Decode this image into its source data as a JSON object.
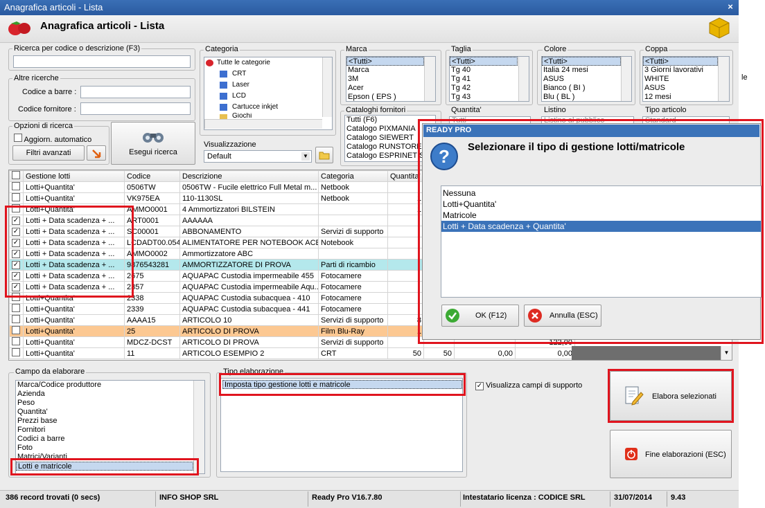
{
  "window": {
    "title": "Anagrafica articoli  - Lista",
    "close": "×"
  },
  "header": {
    "title": "Anagrafica articoli  - Lista"
  },
  "search": {
    "label": "Ricerca per codice o descrizione (F3)",
    "value": ""
  },
  "altre": {
    "label": "Altre ricerche",
    "barcode_label": "Codice a barre :",
    "supplier_label": "Codice fornitore :"
  },
  "options": {
    "label": "Opzioni di ricerca",
    "auto": "Aggiorn. automatico",
    "filters": "Filtri avanzati",
    "search_btn": "Esegui ricerca"
  },
  "categoria": {
    "label": "Categoria",
    "items": [
      "Tutte le categorie",
      "CRT",
      "Laser",
      "LCD",
      "Cartucce inkjet",
      "Giochi"
    ]
  },
  "marca": {
    "label": "Marca",
    "items": [
      "<Tutti>",
      "Marca",
      "3M",
      "Acer",
      "Epson ( EPS )"
    ]
  },
  "taglia": {
    "label": "Taglia",
    "items": [
      "<Tutti>",
      "Tg 40",
      "Tg 41",
      "Tg 42",
      "Tg 43"
    ]
  },
  "colore": {
    "label": "Colore",
    "items": [
      "<Tutti>",
      "Italia 24 mesi",
      "ASUS",
      "Bianco ( BI )",
      "Blu ( BL )"
    ]
  },
  "coppa": {
    "label": "Coppa",
    "items": [
      "<Tutti>",
      "3 Giorni lavorativi",
      "WHITE",
      "ASUS",
      "12 mesi"
    ]
  },
  "cataloghi": {
    "label": "Cataloghi fornitori",
    "items": [
      "Tutti (F6)",
      "Catalogo PIXMANIA",
      "Catalogo SIEWERT",
      "Catalogo RUNSTORE",
      "Catalogo ESPRINET SPA"
    ]
  },
  "quantita": {
    "label": "Quantita'",
    "value": "Tutti"
  },
  "listino": {
    "label": "Listino",
    "value": "Listino al pubblico"
  },
  "tipo_articolo": {
    "label": "Tipo articolo",
    "value": "Standard"
  },
  "visualizzazione": {
    "label": "Visualizzazione",
    "value": "Default"
  },
  "side_text": "le",
  "grid": {
    "headers": [
      "Gestione lotti",
      "Codice",
      "Descrizione",
      "Categoria",
      "Quantita'"
    ],
    "rows": [
      {
        "checked": false,
        "lotti": "Lotti+Quantita'",
        "codice": "0506TW",
        "desc": "0506TW  - Fucile elettrico Full Metal m...",
        "cat": "Netbook",
        "q": "",
        "bg": "#ffffff"
      },
      {
        "checked": false,
        "lotti": "Lotti+Quantita'",
        "codice": "VK975EA",
        "desc": "110-1130SL",
        "cat": "Netbook",
        "q": "1",
        "bg": "#ffffff"
      },
      {
        "checked": false,
        "lotti": "Lotti+Quantita'",
        "codice": "AMMO0001",
        "desc": "4 Ammortizzatori BILSTEIN",
        "cat": "",
        "q": "1",
        "bg": "#ffffff"
      },
      {
        "checked": true,
        "lotti": "Lotti + Data scadenza + ...",
        "codice": "ART0001",
        "desc": "AAAAAA",
        "cat": "",
        "q": "",
        "bg": "#ffffff"
      },
      {
        "checked": true,
        "lotti": "Lotti + Data scadenza + ...",
        "codice": "SC00001",
        "desc": "ABBONAMENTO",
        "cat": "Servizi di supporto",
        "q": "",
        "bg": "#ffffff"
      },
      {
        "checked": true,
        "lotti": "Lotti + Data scadenza + ...",
        "codice": "LCDADT00.054",
        "desc": "ALIMENTATORE PER NOTEBOOK ACER",
        "cat": "Notebook",
        "q": "",
        "bg": "#ffffff"
      },
      {
        "checked": true,
        "lotti": "Lotti + Data scadenza + ...",
        "codice": "AMMO0002",
        "desc": "Ammortizzatore ABC",
        "cat": "",
        "q": "",
        "bg": "#ffffff"
      },
      {
        "checked": true,
        "lotti": "Lotti + Data scadenza + ...",
        "codice": "9876543281",
        "desc": "AMMORTIZZATORE DI PROVA",
        "cat": "Parti di ricambio",
        "q": "",
        "bg": "#b4e8ec"
      },
      {
        "checked": true,
        "lotti": "Lotti + Data scadenza + ...",
        "codice": "2675",
        "desc": "AQUAPAC Custodia impermeabile 455",
        "cat": "Fotocamere",
        "q": "",
        "bg": "#ffffff"
      },
      {
        "checked": true,
        "lotti": "Lotti + Data scadenza + ...",
        "codice": "2357",
        "desc": "AQUAPAC Custodia impermeabile Aqu...",
        "cat": "Fotocamere",
        "q": "",
        "bg": "#ffffff"
      },
      {
        "checked": false,
        "lotti": "Lotti+Quantita'",
        "codice": "2338",
        "desc": "AQUAPAC Custodia subacquea - 410",
        "cat": "Fotocamere",
        "q": "",
        "bg": "#ffffff"
      },
      {
        "checked": false,
        "lotti": "Lotti+Quantita'",
        "codice": "2339",
        "desc": "AQUAPAC Custodia subacquea - 441",
        "cat": "Fotocamere",
        "q": "",
        "bg": "#ffffff"
      },
      {
        "checked": false,
        "lotti": "Lotti+Quantita'",
        "codice": "AAAA15",
        "desc": "ARTICOLO 10",
        "cat": "Servizi di supporto",
        "q": "8",
        "bg": "#ffffff"
      },
      {
        "checked": false,
        "lotti": "Lotti+Quantita'",
        "codice": "25",
        "desc": "ARTICOLO DI PROVA",
        "cat": "Film Blu-Ray",
        "q": "1",
        "bg": "#fcc892"
      },
      {
        "checked": false,
        "lotti": "Lotti+Quantita'",
        "codice": "MDCZ-DCST",
        "desc": "ARTICOLO DI PROVA",
        "cat": "Servizi di supporto",
        "q": "",
        "bg": "#ffffff"
      },
      {
        "checked": false,
        "lotti": "Lotti+Quantita'",
        "codice": "11",
        "desc": "ARTICOLO ESEMPIO 2",
        "cat": "CRT",
        "q": "50",
        "bg": "#ffffff"
      }
    ],
    "last_extra": [
      "50",
      "0,00",
      "0,00"
    ],
    "partial_extra": [
      "122,00"
    ]
  },
  "campo": {
    "label": "Campo da elaborare",
    "items": [
      "Marca/Codice produttore",
      "Azienda",
      "Peso",
      "Quantita'",
      "Prezzi base",
      "Fornitori",
      "Codici a barre",
      "Foto",
      "Matrici/Varianti",
      "Lotti e matricole"
    ]
  },
  "tipo_elab": {
    "label": "Tipo elaborazione",
    "item": "Imposta tipo gestione lotti e matricole"
  },
  "visualizza_supporto": "Visualizza campi di supporto",
  "elabora_btn": "Elabora selezionati",
  "fine_btn": "Fine elaborazioni (ESC)",
  "status": {
    "records": "386 record trovati (0 secs)",
    "company": "INFO SHOP SRL",
    "version": "Ready Pro V16.7.80",
    "licensee": "Intestatario licenza : CODICE SRL",
    "date": "31/07/2014",
    "time": "9.43"
  },
  "dialog": {
    "title": "READY PRO",
    "question": "Selezionare il tipo di gestione lotti/matricole",
    "options": [
      "Nessuna",
      "Lotti+Quantita'",
      "Matricole",
      "Lotti + Data scadenza + Quantita'"
    ],
    "ok": "OK (F12)",
    "cancel": "Annulla (ESC)"
  },
  "colors": {
    "title_bar": "#2a5aa0",
    "highlight_red": "#e0141e",
    "selection": "#c5d8ef",
    "row_cyan": "#b4e8ec",
    "row_orange": "#fcc892"
  }
}
